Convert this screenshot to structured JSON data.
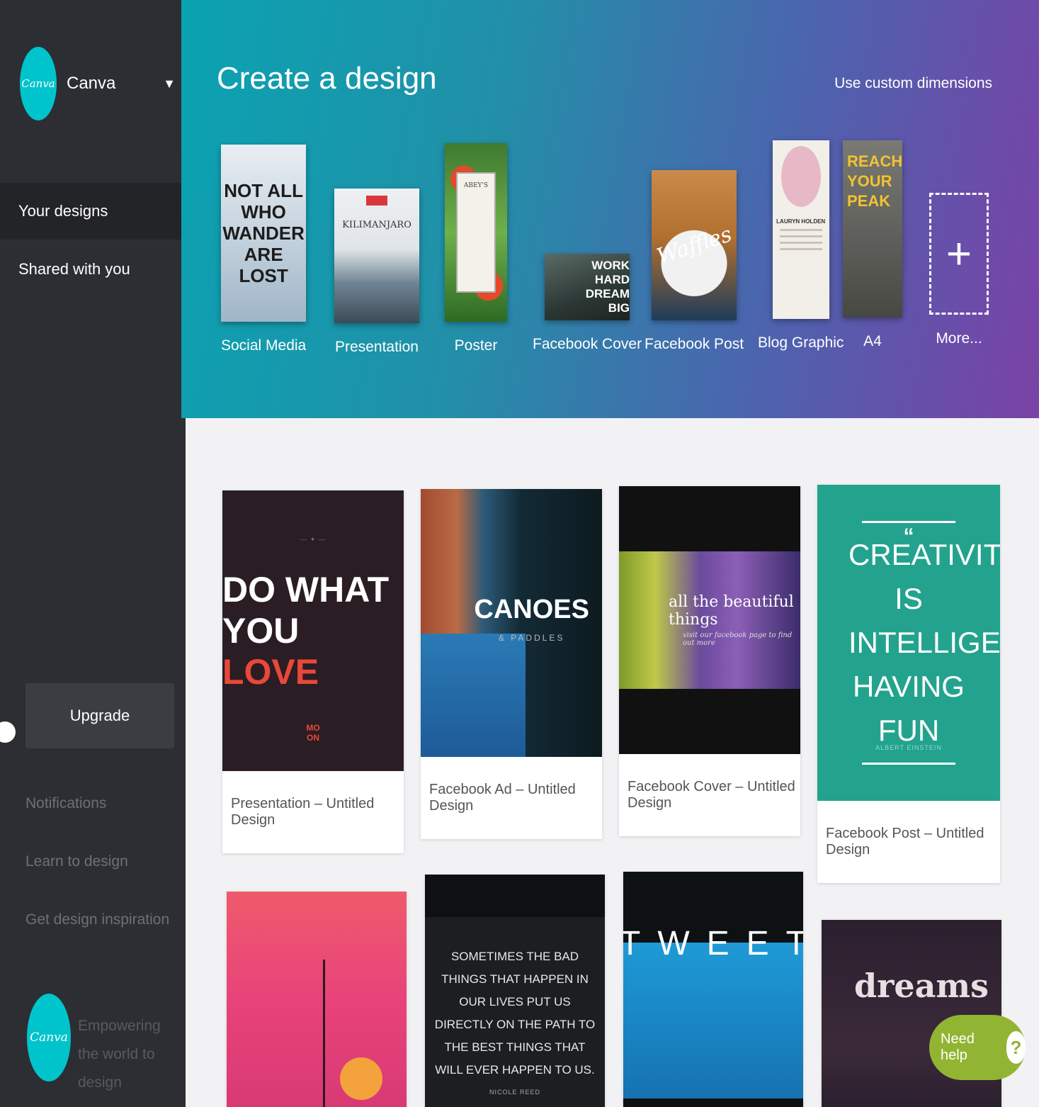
{
  "sidebar": {
    "logo_text": "Canva",
    "brand_name": "Canva",
    "nav": [
      {
        "label": "Your designs",
        "active": true
      },
      {
        "label": "Shared with you",
        "active": false
      }
    ],
    "upgrade_label": "Upgrade",
    "links": [
      "Notifications",
      "Learn to design",
      "Get design inspiration"
    ],
    "footer_logo_text": "Canva",
    "tagline": "Empowering the world to design"
  },
  "hero": {
    "title": "Create a design",
    "custom_dimensions": "Use custom dimensions",
    "types": [
      {
        "label": "Social Media",
        "thumb_text": "NOT ALL WHO WANDER ARE LOST"
      },
      {
        "label": "Presentation",
        "thumb_text": "KILIMANJARO"
      },
      {
        "label": "Poster",
        "thumb_text": "ABEY'S"
      },
      {
        "label": "Facebook Cover",
        "thumb_text": "WORK HARD DREAM BIG"
      },
      {
        "label": "Facebook Post",
        "thumb_text": "Waffles"
      },
      {
        "label": "Blog Graphic",
        "thumb_text": "LAURYN HOLDEN"
      },
      {
        "label": "A4",
        "thumb_text": "REACH YOUR PEAK"
      },
      {
        "label": "More...",
        "thumb_text": "+"
      }
    ]
  },
  "designs": [
    {
      "caption": "Presentation – Untitled Design",
      "line1": "DO WHAT",
      "line2a": "YOU ",
      "line2b": "LOVE",
      "mark1": "MO",
      "mark2": "ON"
    },
    {
      "caption": "Facebook Ad – Untitled Design",
      "title": "CANOES",
      "subtitle": "& PADDLES"
    },
    {
      "caption": "Facebook Cover – Untitled Design",
      "title": "all the beautiful things",
      "subtitle": "visit our facebook page to find out more"
    },
    {
      "caption": "Facebook Post – Untitled Design",
      "quote_mark": "“",
      "quote": "CREATIVITY IS INTELLIGENCE HAVING FUN",
      "author": "ALBERT EINSTEIN"
    },
    {
      "caption": ""
    },
    {
      "quote": "SOMETIMES THE BAD THINGS THAT HAPPEN IN OUR LIVES PUT US DIRECTLY ON THE PATH TO THE BEST THINGS THAT WILL EVER HAPPEN TO US.",
      "author": "NICOLE REED"
    },
    {
      "title": "TWEET"
    },
    {
      "title": "dreams"
    }
  ],
  "help": {
    "label": "Need help",
    "icon": "?"
  }
}
